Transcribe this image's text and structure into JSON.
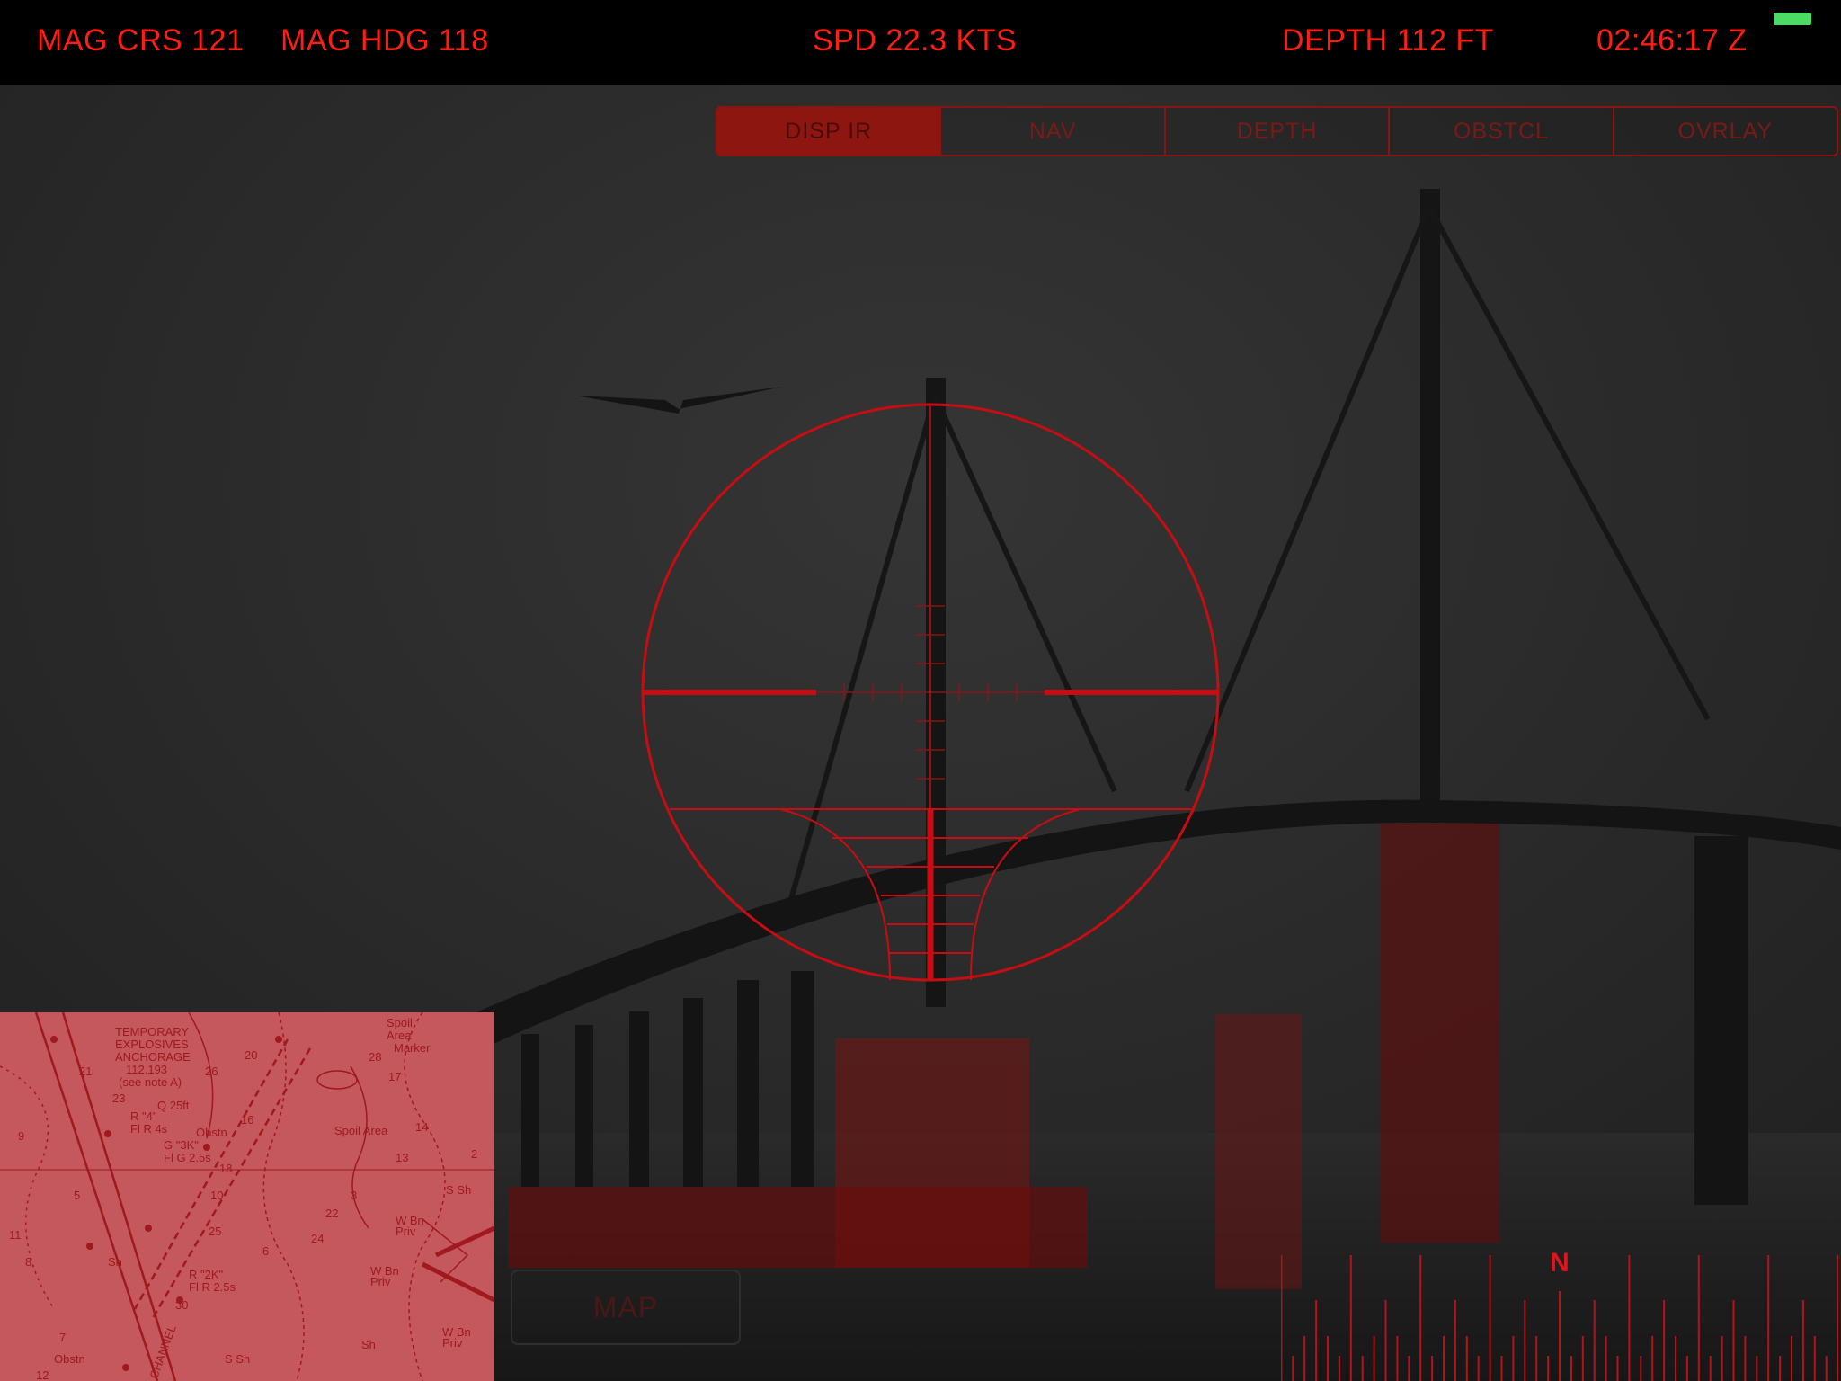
{
  "status_bar": {
    "mag_crs": "MAG CRS 121",
    "mag_hdg": "MAG HDG 118",
    "speed": "SPD 22.3 KTS",
    "depth": "DEPTH 112 FT",
    "clock": "02:46:17 Z"
  },
  "modes": {
    "selected": "DISP IR",
    "tabs": [
      "DISP IR",
      "NAV",
      "DEPTH",
      "OBSTCL",
      "OVRLAY"
    ]
  },
  "compass": {
    "north_label": "N"
  },
  "map_button": {
    "label": "MAP"
  },
  "chart_inset": {
    "labels": [
      "TEMPORARY",
      "EXPLOSIVES",
      "ANCHORAGE",
      "112.193",
      "(see note A)",
      "Spoil",
      "Area",
      "Marker",
      "R \"4\"",
      "Fl R 4s",
      "G \"3K\"",
      "Fl G 2.5s",
      "R \"2K\"",
      "Fl R 2.5s",
      "Q 25ft",
      "Obstn",
      "Obstn",
      "Spoil Area",
      "W Bn",
      "Priv",
      "W Bn",
      "Priv",
      "W Bn",
      "Priv",
      "S Sh",
      "Sh",
      "S Sh",
      "Sh",
      "CHANNEL",
      "26",
      "28",
      "23",
      "20",
      "21",
      "17",
      "14",
      "16",
      "13",
      "9",
      "5",
      "10",
      "30",
      "22",
      "24",
      "12",
      "7",
      "8",
      "11",
      "18",
      "25",
      "2",
      "3",
      "6"
    ]
  },
  "colors": {
    "hud_red": "#ff1e14",
    "reticle": "#c80d12",
    "segment_active": "#8e1610",
    "battery": "#4cd964",
    "chart_tint": "#c4585c"
  }
}
